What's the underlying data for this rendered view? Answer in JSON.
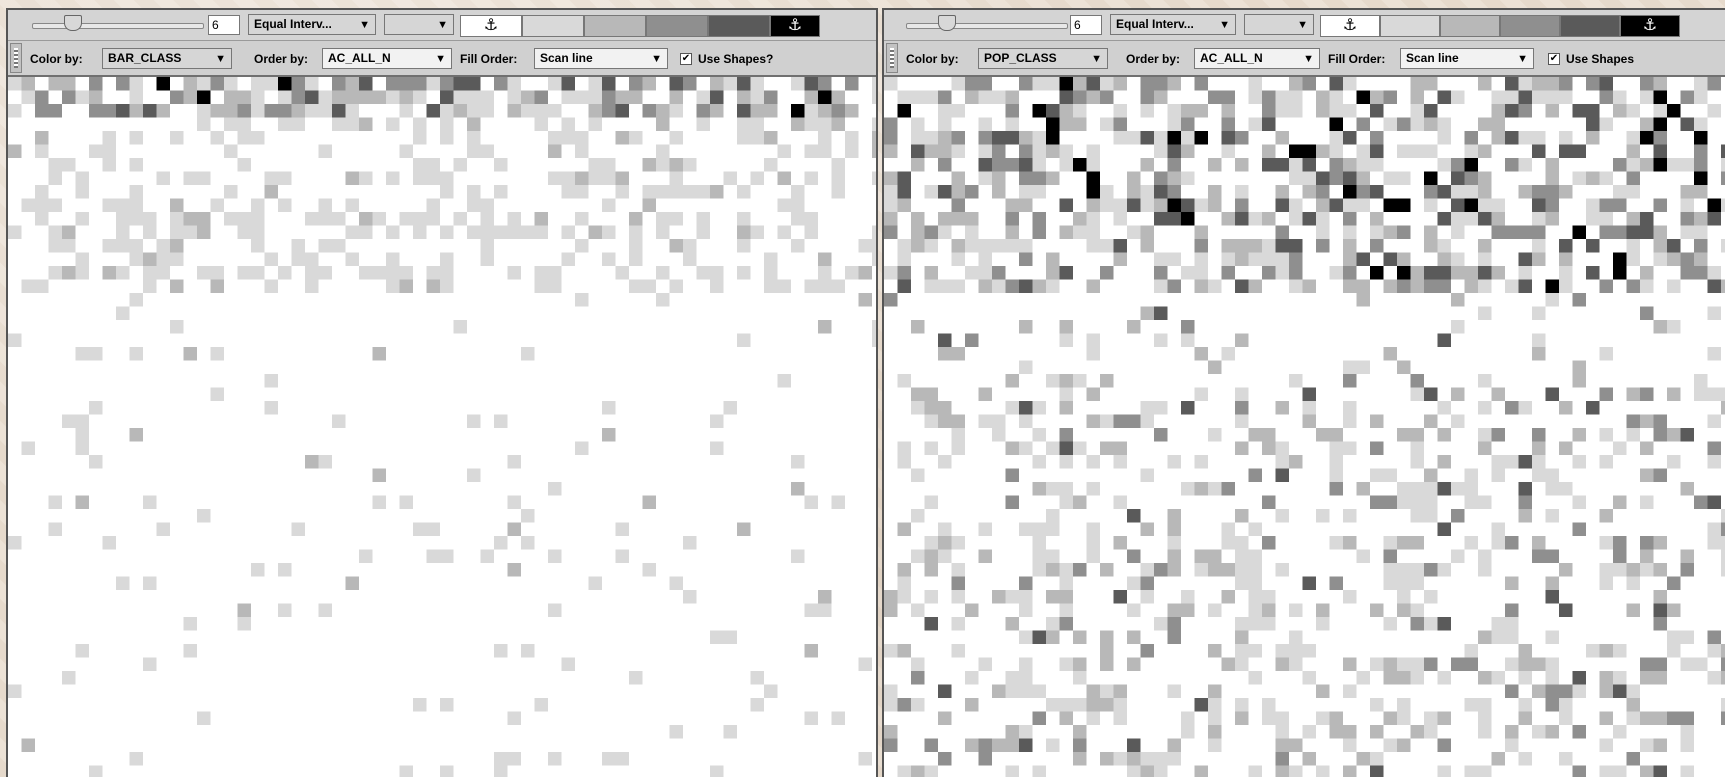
{
  "panels": [
    {
      "id": "left",
      "classes_count": "6",
      "classification": "Equal Interv...",
      "color_by_label": "Color by:",
      "color_by_value": "BAR_CLASS",
      "order_by_label": "Order by:",
      "order_by_value": "AC_ALL_N",
      "fill_order_label": "Fill Order:",
      "fill_order_value": "Scan line",
      "use_shapes_label": "Use Shapes?",
      "use_shapes_checked": "✔",
      "palette": [
        "#ffffff",
        "#d9d9d9",
        "#b8b8b8",
        "#8f8f8f",
        "#5a5a5a",
        "#000000"
      ]
    },
    {
      "id": "right",
      "classes_count": "6",
      "classification": "Equal Interv...",
      "color_by_label": "Color by:",
      "color_by_value": "POP_CLASS",
      "order_by_label": "Order by:",
      "order_by_value": "AC_ALL_N",
      "fill_order_label": "Fill Order:",
      "fill_order_value": "Scan line",
      "use_shapes_label": "Use Shapes",
      "use_shapes_checked": "✔",
      "palette": [
        "#ffffff",
        "#d9d9d9",
        "#b8b8b8",
        "#8f8f8f",
        "#5a5a5a",
        "#000000"
      ]
    }
  ],
  "icons": {
    "anchor": "⚓",
    "dropdown": "▼"
  }
}
